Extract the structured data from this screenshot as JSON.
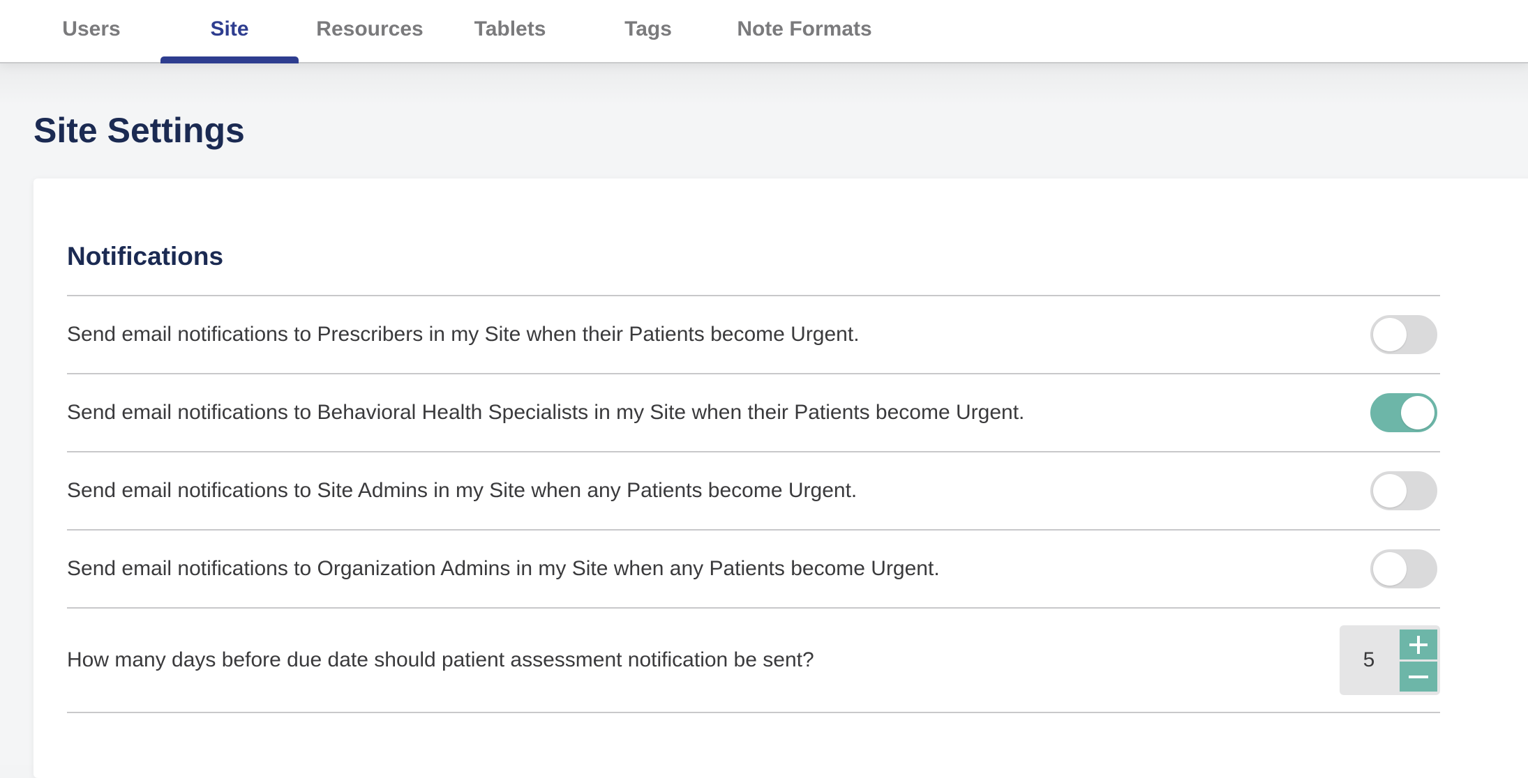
{
  "tabs": [
    {
      "label": "Users",
      "active": false
    },
    {
      "label": "Site",
      "active": true
    },
    {
      "label": "Resources",
      "active": false
    },
    {
      "label": "Tablets",
      "active": false
    },
    {
      "label": "Tags",
      "active": false
    },
    {
      "label": "Note Formats",
      "active": false
    }
  ],
  "page": {
    "title": "Site Settings"
  },
  "notifications": {
    "title": "Notifications",
    "settings": [
      {
        "label": "Send email notifications to Prescribers in my Site when their Patients become Urgent.",
        "enabled": false
      },
      {
        "label": "Send email notifications to Behavioral Health Specialists in my Site when their Patients become Urgent.",
        "enabled": true
      },
      {
        "label": "Send email notifications to Site Admins in my Site when any Patients become Urgent.",
        "enabled": false
      },
      {
        "label": "Send email notifications to Organization Admins in my Site when any Patients become Urgent.",
        "enabled": false
      }
    ],
    "days_setting": {
      "label": "How many days before due date should patient assessment notification be sent?",
      "value": "5",
      "increment_icon": "plus-icon",
      "decrement_icon": "minus-icon"
    }
  },
  "colors": {
    "accent": "#2e3d8f",
    "toggle_on": "#6db6a8",
    "title": "#1b2a52"
  }
}
